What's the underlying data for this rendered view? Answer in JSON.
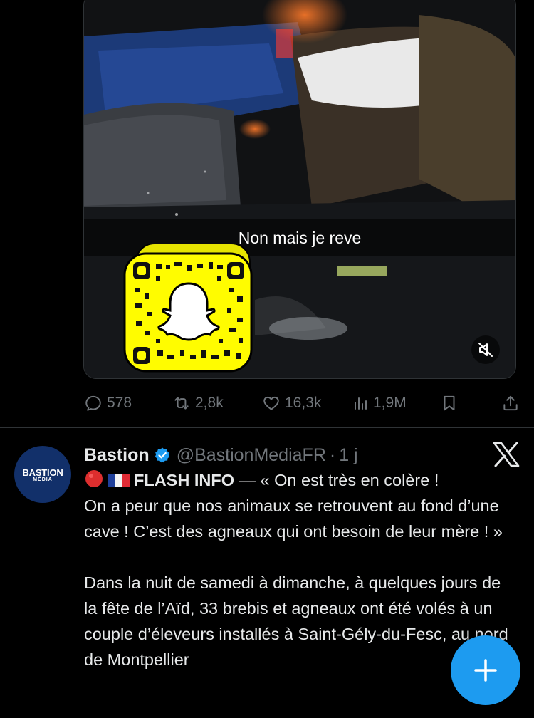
{
  "video": {
    "caption": "Non mais je reve",
    "snapcode_icon": "snapchat-snapcode-icon",
    "mute_icon": "speaker-muted-icon"
  },
  "actions": {
    "replies": "578",
    "reposts": "2,8k",
    "likes": "16,3k",
    "views": "1,9M"
  },
  "tweet": {
    "display_name": "Bastion",
    "handle": "@BastionMediaFR",
    "separator": "·",
    "time": "1 j",
    "avatar_text": "BASTION",
    "avatar_subtext": "MÉDIA",
    "flash_label": "FLASH INFO",
    "line1_rest": " — « On est très en colère !",
    "para1": "On a peur que nos animaux se retrouvent au fond d’une cave ! C’est des agneaux qui ont besoin de leur mère ! »",
    "para2": "Dans la nuit de samedi à dimanche, à quelques jours de la fête de l’Aïd, 33 brebis et agneaux ont été volés à un couple d’éleveurs installés à Saint-Gély-du-Fesc, au nord de Montpellier"
  },
  "colors": {
    "accent": "#1d9bf0",
    "background": "#000000",
    "muted_text": "#71767b",
    "snapchat_yellow": "#fffc00"
  }
}
